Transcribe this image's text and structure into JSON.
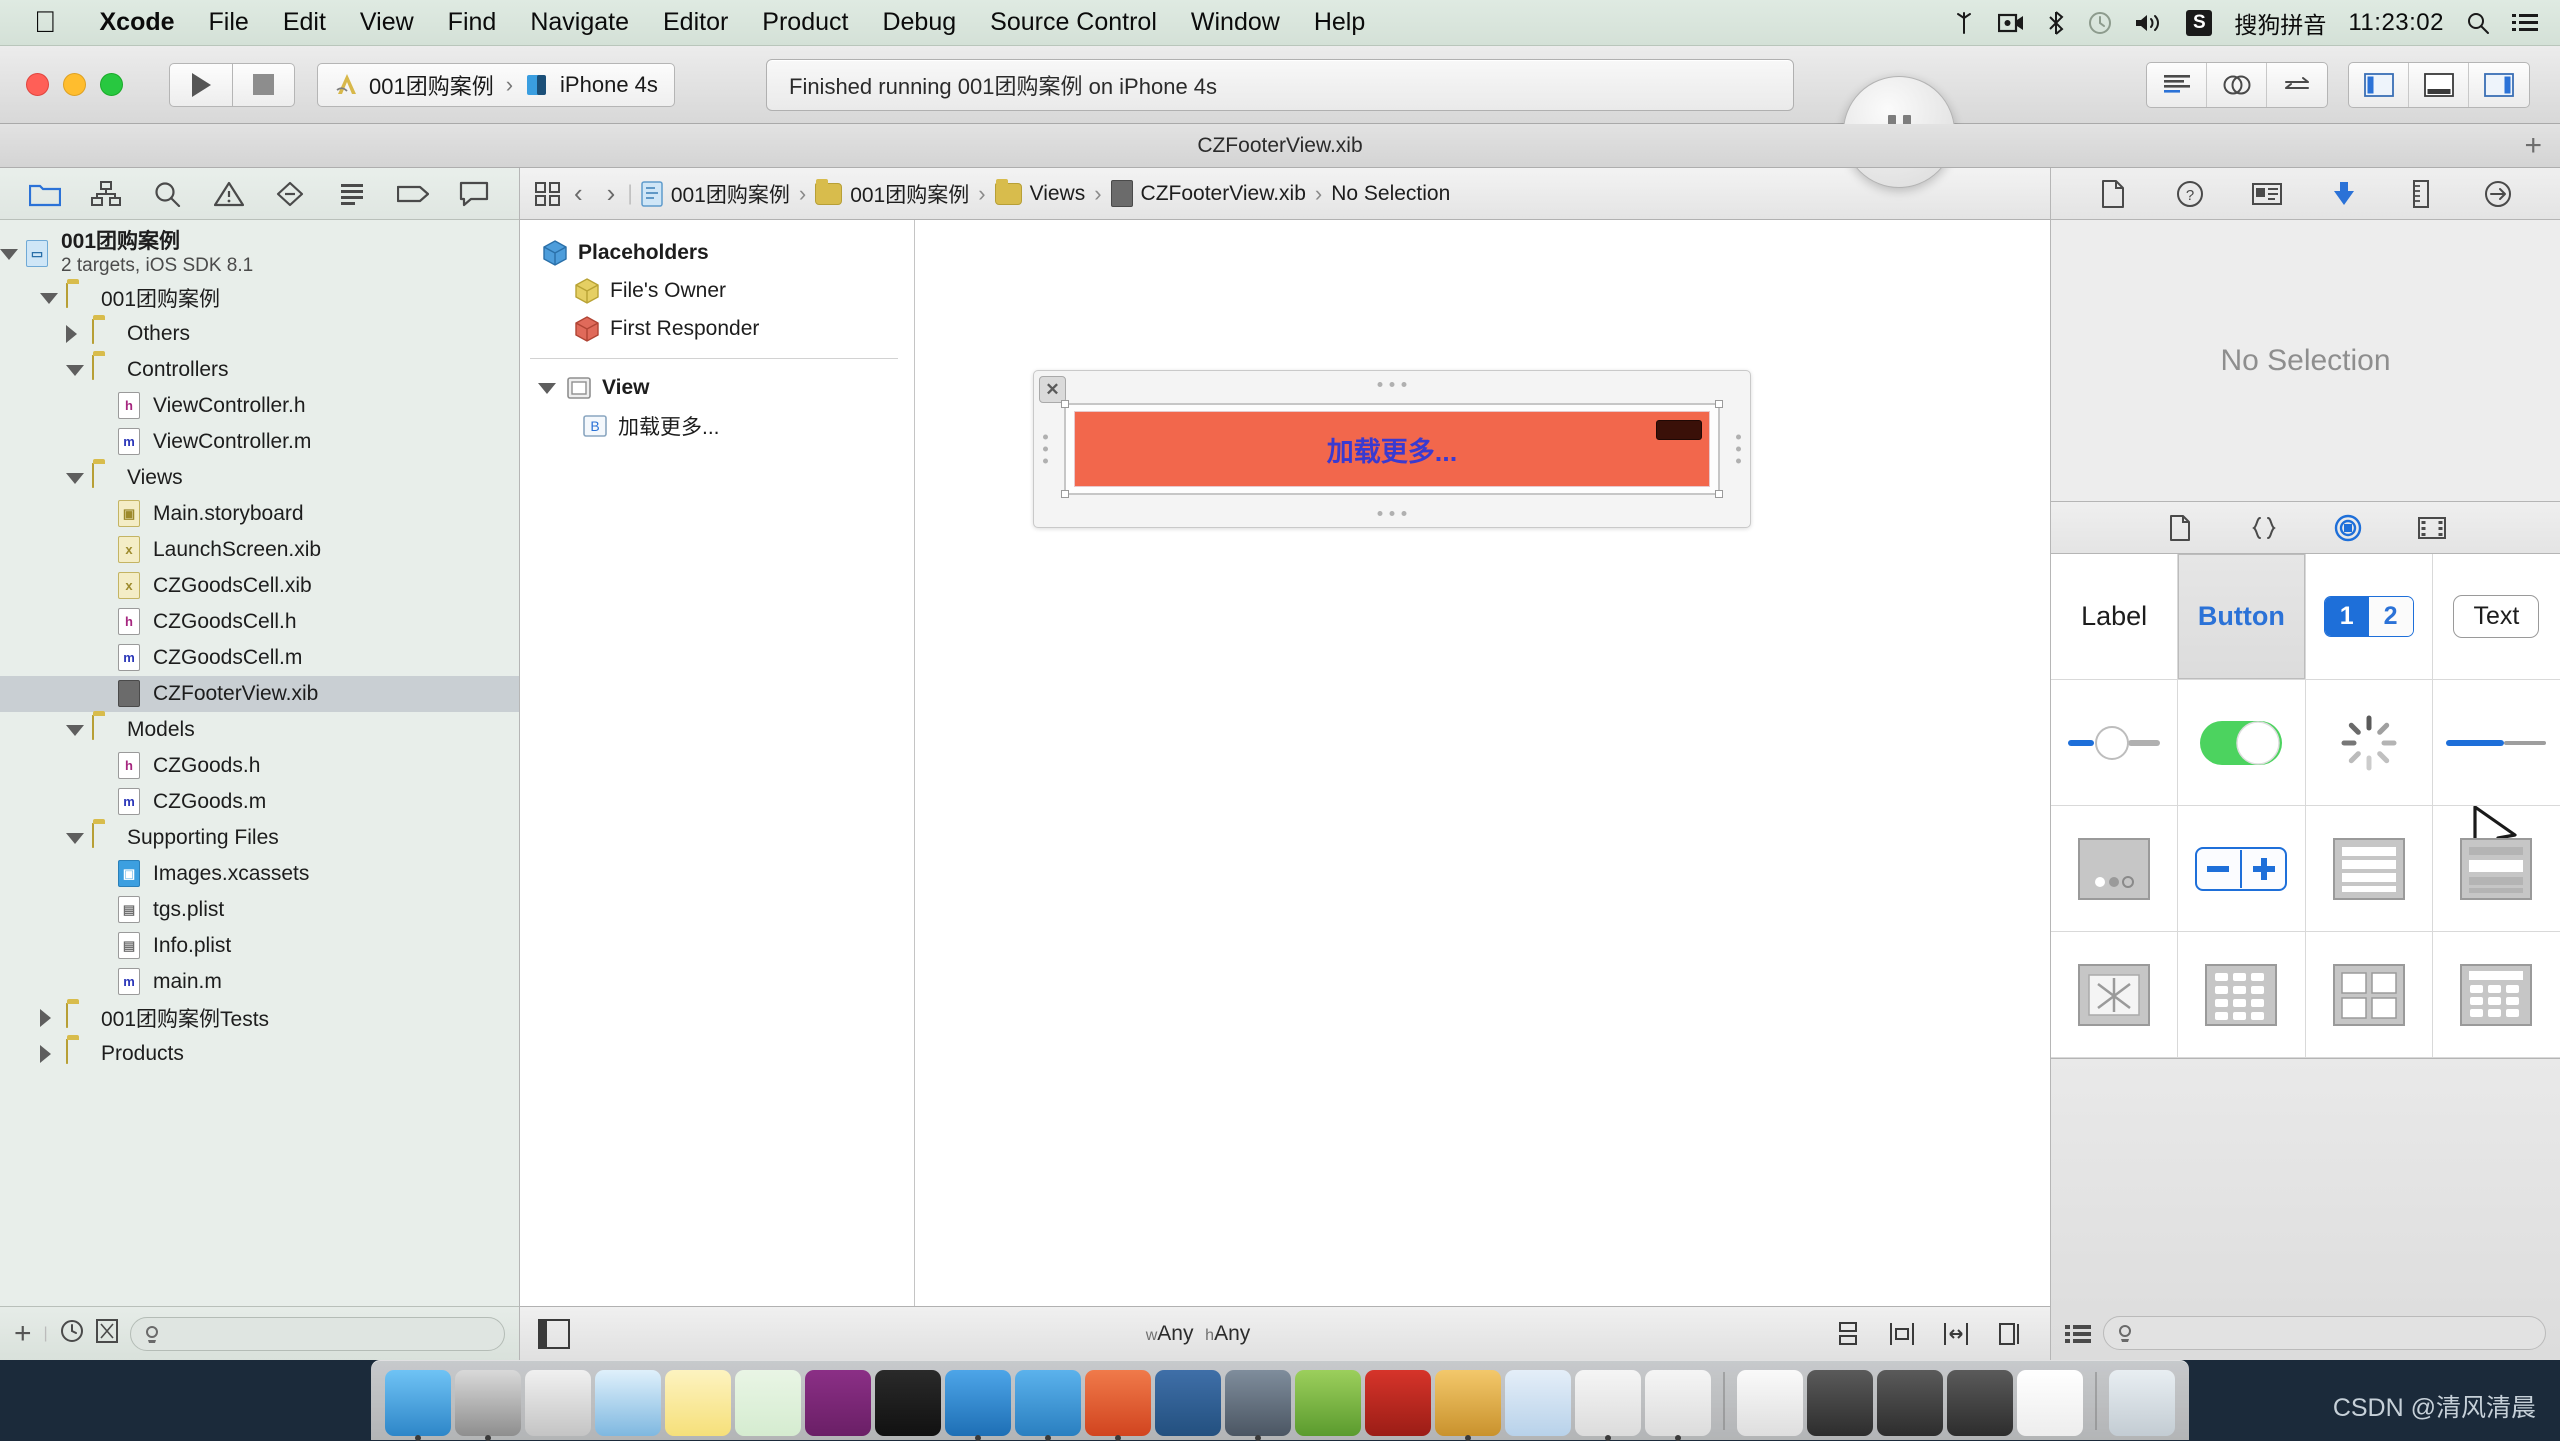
{
  "menubar": {
    "apple_icon": "apple-logo-icon",
    "items": [
      {
        "label": "Xcode",
        "bold": true
      },
      {
        "label": "File",
        "bold": false
      },
      {
        "label": "Edit",
        "bold": false
      },
      {
        "label": "View",
        "bold": false
      },
      {
        "label": "Find",
        "bold": false
      },
      {
        "label": "Navigate",
        "bold": false
      },
      {
        "label": "Editor",
        "bold": false
      },
      {
        "label": "Product",
        "bold": false
      },
      {
        "label": "Debug",
        "bold": false
      },
      {
        "label": "Source Control",
        "bold": false
      },
      {
        "label": "Window",
        "bold": false
      },
      {
        "label": "Help",
        "bold": false
      }
    ],
    "status": {
      "shuttle_icon": "airdrop-icon",
      "screen_record_icon": "video-camera-icon",
      "bluetooth_icon": "bluetooth-icon",
      "timemachine_icon": "clock-icon",
      "volume_icon": "speaker-icon",
      "ime_badge": "S",
      "ime_label": "搜狗拼音",
      "clock": "11:23:02",
      "search_icon": "search-icon",
      "notification_icon": "list-icon"
    }
  },
  "toolbar": {
    "run_icon": "play-icon",
    "stop_icon": "stop-icon",
    "scheme_project": "001团购案例",
    "scheme_separator": "›",
    "scheme_destination": "iPhone 4s",
    "status_text": "Finished running 001团购案例 on iPhone 4s",
    "pause_icon": "pause-icon",
    "editor_buttons": [
      {
        "name": "standard-editor-button"
      },
      {
        "name": "assistant-editor-button"
      },
      {
        "name": "version-editor-button"
      }
    ],
    "view_buttons": [
      {
        "name": "toggle-navigator-button"
      },
      {
        "name": "toggle-debug-area-button"
      },
      {
        "name": "toggle-utilities-button"
      }
    ]
  },
  "tabbar": {
    "title": "CZFooterView.xib",
    "add_label": "+"
  },
  "navigator": {
    "tabs": [
      {
        "name": "project-navigator-tab",
        "icon": "folder-icon",
        "selected": true
      },
      {
        "name": "symbol-navigator-tab",
        "icon": "hierarchy-icon",
        "selected": false
      },
      {
        "name": "find-navigator-tab",
        "icon": "search-icon",
        "selected": false
      },
      {
        "name": "issue-navigator-tab",
        "icon": "warning-icon",
        "selected": false
      },
      {
        "name": "test-navigator-tab",
        "icon": "diamond-icon",
        "selected": false
      },
      {
        "name": "debug-navigator-tab",
        "icon": "debug-icon",
        "selected": false
      },
      {
        "name": "breakpoint-navigator-tab",
        "icon": "tag-icon",
        "selected": false
      },
      {
        "name": "log-navigator-tab",
        "icon": "speech-bubble-icon",
        "selected": false
      }
    ],
    "project": {
      "name": "001团购案例",
      "subtitle": "2 targets, iOS SDK 8.1"
    },
    "tree": [
      {
        "label": "001团购案例",
        "indent": 1,
        "twisty": "open",
        "icon": "folder",
        "selected": false
      },
      {
        "label": "Others",
        "indent": 2,
        "twisty": "closed",
        "icon": "folder",
        "selected": false
      },
      {
        "label": "Controllers",
        "indent": 2,
        "twisty": "open",
        "icon": "folder",
        "selected": false
      },
      {
        "label": "ViewController.h",
        "indent": 3,
        "twisty": "none",
        "icon": "h",
        "selected": false
      },
      {
        "label": "ViewController.m",
        "indent": 3,
        "twisty": "none",
        "icon": "m",
        "selected": false
      },
      {
        "label": "Views",
        "indent": 2,
        "twisty": "open",
        "icon": "folder",
        "selected": false
      },
      {
        "label": "Main.storyboard",
        "indent": 3,
        "twisty": "none",
        "icon": "sb",
        "selected": false
      },
      {
        "label": "LaunchScreen.xib",
        "indent": 3,
        "twisty": "none",
        "icon": "xib",
        "selected": false
      },
      {
        "label": "CZGoodsCell.xib",
        "indent": 3,
        "twisty": "none",
        "icon": "xib",
        "selected": false
      },
      {
        "label": "CZGoodsCell.h",
        "indent": 3,
        "twisty": "none",
        "icon": "h",
        "selected": false
      },
      {
        "label": "CZGoodsCell.m",
        "indent": 3,
        "twisty": "none",
        "icon": "m",
        "selected": false
      },
      {
        "label": "CZFooterView.xib",
        "indent": 3,
        "twisty": "none",
        "icon": "dark",
        "selected": true
      },
      {
        "label": "Models",
        "indent": 2,
        "twisty": "open",
        "icon": "folder",
        "selected": false
      },
      {
        "label": "CZGoods.h",
        "indent": 3,
        "twisty": "none",
        "icon": "h",
        "selected": false
      },
      {
        "label": "CZGoods.m",
        "indent": 3,
        "twisty": "none",
        "icon": "m",
        "selected": false
      },
      {
        "label": "Supporting Files",
        "indent": 2,
        "twisty": "open",
        "icon": "folder",
        "selected": false
      },
      {
        "label": "Images.xcassets",
        "indent": 3,
        "twisty": "none",
        "icon": "xcassets",
        "selected": false
      },
      {
        "label": "tgs.plist",
        "indent": 3,
        "twisty": "none",
        "icon": "plist",
        "selected": false
      },
      {
        "label": "Info.plist",
        "indent": 3,
        "twisty": "none",
        "icon": "plist",
        "selected": false
      },
      {
        "label": "main.m",
        "indent": 3,
        "twisty": "none",
        "icon": "m",
        "selected": false
      },
      {
        "label": "001团购案例Tests",
        "indent": 1,
        "twisty": "closed",
        "icon": "folder",
        "selected": false
      },
      {
        "label": "Products",
        "indent": 1,
        "twisty": "closed",
        "icon": "folder",
        "selected": false
      }
    ],
    "footer": {
      "add_label": "+",
      "recent_icon": "clock-icon",
      "source_control_icon": "source-control-icon",
      "filter_placeholder": ""
    }
  },
  "editor": {
    "jumpbar": {
      "related_icon": "related-files-icon",
      "back_label": "‹",
      "forward_label": "›",
      "crumbs": [
        {
          "label": "001团购案例",
          "icon": "project-icon"
        },
        {
          "label": "001团购案例",
          "icon": "folder-icon"
        },
        {
          "label": "Views",
          "icon": "folder-icon"
        },
        {
          "label": "CZFooterView.xib",
          "icon": "xib-icon"
        },
        {
          "label": "No Selection",
          "icon": "none"
        }
      ],
      "separator": "›"
    },
    "outline": {
      "placeholders_label": "Placeholders",
      "items": [
        {
          "label": "File's Owner",
          "icon": "yellow-cube-icon",
          "indent": 1,
          "bold": false
        },
        {
          "label": "First Responder",
          "icon": "red-cube-icon",
          "indent": 1,
          "bold": false
        }
      ],
      "view_label": "View",
      "children": [
        {
          "label": "加载更多...",
          "icon": "button-icon",
          "indent": 2,
          "bold": false
        }
      ]
    },
    "canvas": {
      "button_title": "加载更多...",
      "button_bg_color": "#f2674c",
      "button_text_color": "#3a3ad0",
      "close_label": "✕"
    },
    "footer": {
      "size_class_w": "w",
      "size_class_w_value": "Any",
      "size_class_h": "h",
      "size_class_h_value": "Any",
      "buttons": [
        {
          "name": "stack-button"
        },
        {
          "name": "align-button"
        },
        {
          "name": "pin-button"
        },
        {
          "name": "resolve-auto-layout-button"
        }
      ]
    }
  },
  "utilities": {
    "inspector_tabs": [
      {
        "name": "file-inspector-tab",
        "icon": "document-icon",
        "selected": false
      },
      {
        "name": "quick-help-inspector-tab",
        "icon": "question-icon",
        "selected": false
      },
      {
        "name": "identity-inspector-tab",
        "icon": "identity-card-icon",
        "selected": false
      },
      {
        "name": "attributes-inspector-tab",
        "icon": "down-arrow-icon",
        "selected": true
      },
      {
        "name": "size-inspector-tab",
        "icon": "ruler-icon",
        "selected": false
      },
      {
        "name": "connections-inspector-tab",
        "icon": "arrow-circle-icon",
        "selected": false
      }
    ],
    "inspector_empty_text": "No Selection",
    "library_tabs": [
      {
        "name": "file-template-library-tab",
        "icon": "document-icon",
        "selected": false
      },
      {
        "name": "code-snippet-library-tab",
        "icon": "braces-icon",
        "selected": false
      },
      {
        "name": "object-library-tab",
        "icon": "circle-target-icon",
        "selected": true
      },
      {
        "name": "media-library-tab",
        "icon": "film-icon",
        "selected": false
      }
    ],
    "library_items": [
      {
        "name": "label-object",
        "label": "Label",
        "kind": "text",
        "selected": false
      },
      {
        "name": "button-object",
        "label": "Button",
        "kind": "button",
        "selected": true
      },
      {
        "name": "segmented-control-object",
        "label": "",
        "kind": "segmented",
        "seg_a": "1",
        "seg_b": "2",
        "selected": false
      },
      {
        "name": "text-field-object",
        "label": "Text",
        "kind": "textfield",
        "selected": false
      },
      {
        "name": "slider-object",
        "label": "",
        "kind": "slider",
        "selected": false
      },
      {
        "name": "switch-object",
        "label": "",
        "kind": "switch",
        "selected": false
      },
      {
        "name": "activity-indicator-object",
        "label": "",
        "kind": "spinner",
        "selected": false
      },
      {
        "name": "progress-view-object",
        "label": "",
        "kind": "progress",
        "selected": false
      },
      {
        "name": "page-control-object",
        "label": "",
        "kind": "pagecontrol",
        "selected": false
      },
      {
        "name": "stepper-object",
        "label": "",
        "kind": "stepper",
        "selected": false
      },
      {
        "name": "table-view-object",
        "label": "",
        "kind": "tableview",
        "selected": false
      },
      {
        "name": "table-view-cell-object",
        "label": "",
        "kind": "tablecell",
        "selected": false
      },
      {
        "name": "image-view-object",
        "label": "",
        "kind": "imageview",
        "selected": false
      },
      {
        "name": "collection-view-object",
        "label": "",
        "kind": "collectionview",
        "selected": false
      },
      {
        "name": "collection-view-cell-object",
        "label": "",
        "kind": "collectioncell",
        "selected": false
      },
      {
        "name": "collection-reusable-view-object",
        "label": "",
        "kind": "collectionreusable",
        "selected": false
      }
    ],
    "library_footer": {
      "list_icon": "list-view-icon",
      "filter_placeholder": ""
    }
  },
  "dock": {
    "items": [
      {
        "name": "finder",
        "running": true
      },
      {
        "name": "system-preferences",
        "running": true
      },
      {
        "name": "launchpad",
        "running": false
      },
      {
        "name": "safari",
        "running": false
      },
      {
        "name": "notes",
        "running": false
      },
      {
        "name": "excel",
        "running": false
      },
      {
        "name": "onenote",
        "running": false
      },
      {
        "name": "terminal",
        "running": false
      },
      {
        "name": "xcode",
        "running": true
      },
      {
        "name": "simulator",
        "running": true
      },
      {
        "name": "powerpoint",
        "running": true
      },
      {
        "name": "snipping-tool",
        "running": false
      },
      {
        "name": "quicktime",
        "running": true
      },
      {
        "name": "evernote",
        "running": false
      },
      {
        "name": "filezilla",
        "running": false
      },
      {
        "name": "image-editor",
        "running": true
      },
      {
        "name": "word",
        "running": false
      },
      {
        "name": "preview-a",
        "running": true
      },
      {
        "name": "preview-b",
        "running": true
      }
    ],
    "stack_items": [
      {
        "name": "documents-stack"
      },
      {
        "name": "downloads-stack-1"
      },
      {
        "name": "downloads-stack-2"
      },
      {
        "name": "downloads-stack-3"
      },
      {
        "name": "white-stack"
      }
    ],
    "trash": {
      "name": "trash"
    }
  },
  "watermark": "CSDN @清风清晨"
}
